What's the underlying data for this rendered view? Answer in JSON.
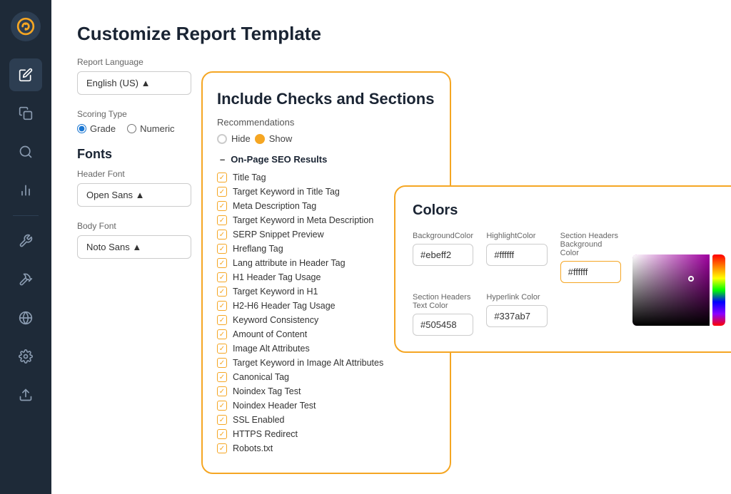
{
  "sidebar": {
    "logo_symbol": "↻",
    "items": [
      {
        "id": "edit",
        "icon": "✎",
        "active": true
      },
      {
        "id": "copy",
        "icon": "⧉",
        "active": false
      },
      {
        "id": "search",
        "icon": "🔍",
        "active": false
      },
      {
        "id": "chart",
        "icon": "📊",
        "active": false
      },
      {
        "id": "tool",
        "icon": "🔧",
        "active": false
      },
      {
        "id": "hammer",
        "icon": "🔨",
        "active": false
      },
      {
        "id": "globe",
        "icon": "🌐",
        "active": false
      },
      {
        "id": "settings",
        "icon": "⚙",
        "active": false
      },
      {
        "id": "upload",
        "icon": "↑",
        "active": false
      }
    ]
  },
  "page": {
    "title": "Customize Report Template"
  },
  "left_panel": {
    "report_language_label": "Report Language",
    "report_language_value": "English (US) ▲",
    "scoring_type_label": "Scoring Type",
    "scoring_grade_label": "Grade",
    "scoring_numeric_label": "Numeric",
    "fonts_heading": "Fonts",
    "header_font_label": "Header Font",
    "header_font_value": "Open Sans ▲",
    "body_font_label": "Body Font",
    "body_font_value": "Noto Sans ▲"
  },
  "checks_panel": {
    "title": "Include Checks and Sections",
    "recommendations_label": "Recommendations",
    "hide_label": "Hide",
    "show_label": "Show",
    "section_header": "On-Page SEO Results",
    "items": [
      "Title Tag",
      "Target Keyword in Title Tag",
      "Meta Description Tag",
      "Target Keyword in Meta Description",
      "SERP Snippet Preview",
      "Hreflang Tag",
      "Lang attribute in Header Tag",
      "H1 Header Tag Usage",
      "Target Keyword in H1",
      "H2-H6 Header Tag Usage",
      "Keyword Consistency",
      "Amount of Content",
      "Image Alt Attributes",
      "Target Keyword in Image Alt Attributes",
      "Canonical Tag",
      "Noindex Tag Test",
      "Noindex Header Test",
      "SSL Enabled",
      "HTTPS Redirect",
      "Robots.txt"
    ]
  },
  "colors_panel": {
    "title": "Colors",
    "fields": [
      {
        "id": "bg",
        "label": "BackgroundColor",
        "value": "#ebeff2",
        "highlighted": false
      },
      {
        "id": "highlight",
        "label": "HighlightColor",
        "value": "#ffffff",
        "highlighted": false
      },
      {
        "id": "section_headers_bg",
        "label": "Section Headers Background Color",
        "value": "#ffffff",
        "highlighted": true
      },
      {
        "id": "section_headers_text",
        "label": "Section Headers Text Color",
        "value": "#505458",
        "highlighted": false
      },
      {
        "id": "hyperlink",
        "label": "Hyperlink Color",
        "value": "#337ab7",
        "highlighted": false
      }
    ]
  }
}
